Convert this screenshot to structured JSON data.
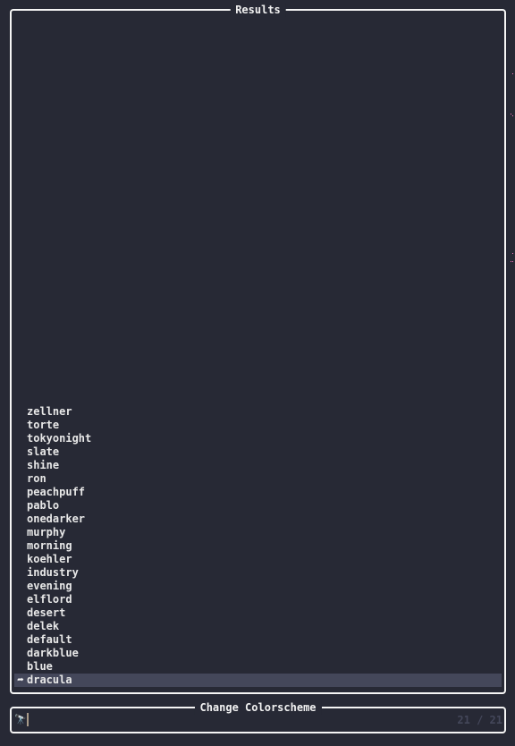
{
  "results": {
    "title": "Results",
    "items": [
      {
        "label": "zellner"
      },
      {
        "label": "torte"
      },
      {
        "label": "tokyonight"
      },
      {
        "label": "slate"
      },
      {
        "label": "shine"
      },
      {
        "label": "ron"
      },
      {
        "label": "peachpuff"
      },
      {
        "label": "pablo"
      },
      {
        "label": "onedarker"
      },
      {
        "label": "murphy"
      },
      {
        "label": "morning"
      },
      {
        "label": "koehler"
      },
      {
        "label": "industry"
      },
      {
        "label": "evening"
      },
      {
        "label": "elflord"
      },
      {
        "label": "desert"
      },
      {
        "label": "delek"
      },
      {
        "label": "default"
      },
      {
        "label": "darkblue"
      },
      {
        "label": "blue"
      },
      {
        "label": "dracula"
      }
    ],
    "selected_index": 20,
    "selection_caret_icon": "share-arrow-icon"
  },
  "prompt": {
    "title": "Change Colorscheme",
    "value": "",
    "prompt_icon": "telescope-icon",
    "counter": "21 / 21"
  },
  "colors": {
    "background": "#272935",
    "selection": "#44475a",
    "border": "#f5f5f5",
    "counter": "#44475a"
  }
}
